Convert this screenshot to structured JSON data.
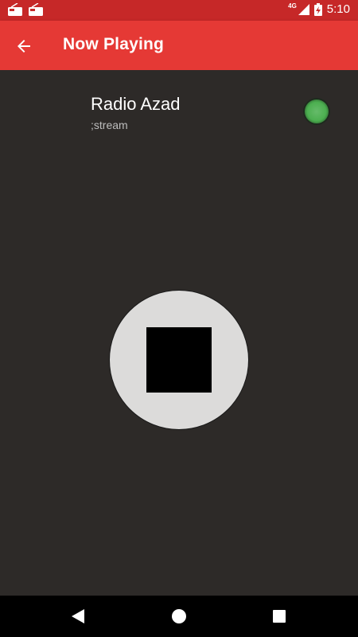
{
  "status_bar": {
    "time": "5:10",
    "network": "4G",
    "notifications": [
      "radio-notification-icon",
      "radio-notification-icon"
    ],
    "battery_icon": "battery-charging-icon",
    "signal_icon": "signal-icon"
  },
  "app_bar": {
    "title": "Now Playing",
    "back_icon": "arrow-back-icon",
    "color": "#e53935"
  },
  "station": {
    "name": "Radio Azad",
    "subtitle": ";stream",
    "status_color": "#4caf50"
  },
  "player": {
    "control_icon": "stop-icon"
  },
  "nav_bar": {
    "back_icon": "nav-back-icon",
    "home_icon": "nav-home-icon",
    "recents_icon": "nav-recents-icon"
  }
}
